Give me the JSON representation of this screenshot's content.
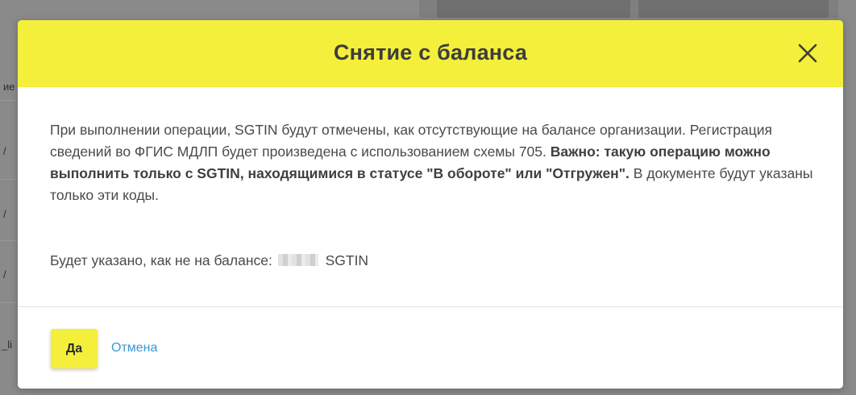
{
  "background": {
    "fragments": [
      "ие",
      "/",
      "/",
      "/",
      "_li"
    ]
  },
  "modal": {
    "title": "Снятие с баланса",
    "close_icon": "close-icon",
    "body": {
      "text_1": "При выполнении операции, SGTIN будут отмечены, как отсутствующие на балансе организации. Регистрация сведений во ФГИС МДЛП будет произведена с использованием схемы 705. ",
      "text_bold": "Важно: такую операцию можно выполнить только с SGTIN, находящимися в статусе \"В обороте\" или \"Отгружен\".",
      "text_2": " В документе будут указаны только эти коды."
    },
    "balance": {
      "prefix": "Будет указано, как не на балансе:",
      "suffix": "SGTIN"
    },
    "buttons": {
      "yes": "Да",
      "cancel": "Отмена"
    }
  },
  "colors": {
    "accent": "#f4ef3a",
    "link": "#3b97d6",
    "overlay": "#8a8a8a"
  }
}
